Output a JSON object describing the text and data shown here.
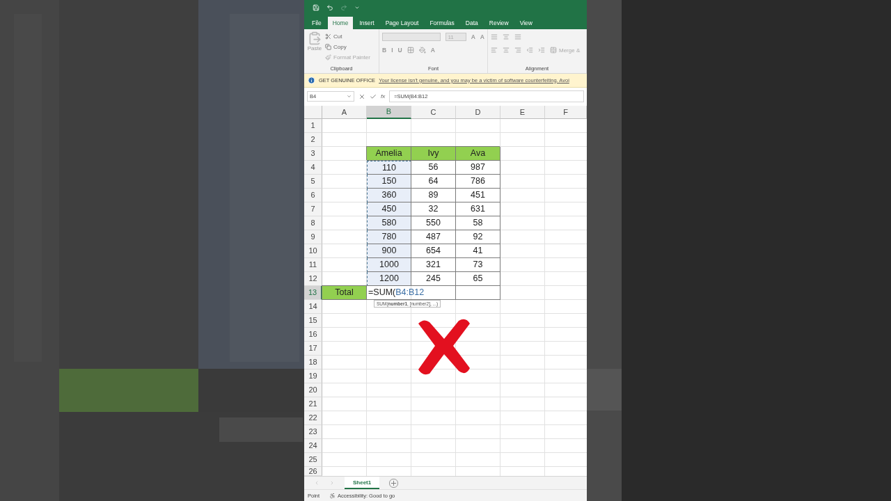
{
  "ribbon_tabs": [
    {
      "label": "File",
      "selected": false
    },
    {
      "label": "Home",
      "selected": true
    },
    {
      "label": "Insert",
      "selected": false
    },
    {
      "label": "Page Layout",
      "selected": false
    },
    {
      "label": "Formulas",
      "selected": false
    },
    {
      "label": "Data",
      "selected": false
    },
    {
      "label": "Review",
      "selected": false
    },
    {
      "label": "View",
      "selected": false
    }
  ],
  "clipboard": {
    "paste": "Paste",
    "cut": "Cut",
    "copy": "Copy",
    "format_painter": "Format Painter",
    "label": "Clipboard"
  },
  "font": {
    "size": "11",
    "grow": [
      "A",
      "A"
    ],
    "styles": [
      "B",
      "I",
      "U"
    ],
    "color_button": "A",
    "label": "Font"
  },
  "alignment": {
    "merge": "Merge &",
    "label": "Alignment"
  },
  "info_bar": {
    "title": "GET GENUINE OFFICE",
    "message": "Your license isn't genuine, and you may be a victim of software counterfeiting. Avoi"
  },
  "formula_bar": {
    "name_box": "B4",
    "function_label": "fx",
    "formula": "=SUM(B4:B12"
  },
  "sheet": {
    "columns": [
      {
        "label": "A",
        "selected": false
      },
      {
        "label": "B",
        "selected": true
      },
      {
        "label": "C",
        "selected": false
      },
      {
        "label": "D",
        "selected": false
      },
      {
        "label": "E",
        "selected": false
      },
      {
        "label": "F",
        "selected": false
      }
    ],
    "rows": [
      {
        "number": "1",
        "selected": false
      },
      {
        "number": "2",
        "selected": false
      },
      {
        "number": "3",
        "selected": false,
        "cells": [
          {
            "kind": "empty"
          },
          {
            "kind": "header",
            "text": "Amelia"
          },
          {
            "kind": "header",
            "text": "Ivy"
          },
          {
            "kind": "header",
            "text": "Ava"
          }
        ]
      },
      {
        "number": "4",
        "selected": false,
        "cells": [
          {
            "kind": "empty"
          },
          {
            "kind": "value",
            "text": "110",
            "marked": true
          },
          {
            "kind": "value",
            "text": "56"
          },
          {
            "kind": "value",
            "text": "987"
          }
        ]
      },
      {
        "number": "5",
        "selected": false,
        "cells": [
          {
            "kind": "empty"
          },
          {
            "kind": "value",
            "text": "150",
            "marked": true
          },
          {
            "kind": "value",
            "text": "64"
          },
          {
            "kind": "value",
            "text": "786"
          }
        ]
      },
      {
        "number": "6",
        "selected": false,
        "cells": [
          {
            "kind": "empty"
          },
          {
            "kind": "value",
            "text": "360",
            "marked": true
          },
          {
            "kind": "value",
            "text": "89"
          },
          {
            "kind": "value",
            "text": "451"
          }
        ]
      },
      {
        "number": "7",
        "selected": false,
        "cells": [
          {
            "kind": "empty"
          },
          {
            "kind": "value",
            "text": "450",
            "marked": true
          },
          {
            "kind": "value",
            "text": "32"
          },
          {
            "kind": "value",
            "text": "631"
          }
        ]
      },
      {
        "number": "8",
        "selected": false,
        "cells": [
          {
            "kind": "empty"
          },
          {
            "kind": "value",
            "text": "580",
            "marked": true
          },
          {
            "kind": "value",
            "text": "550"
          },
          {
            "kind": "value",
            "text": "58"
          }
        ]
      },
      {
        "number": "9",
        "selected": false,
        "cells": [
          {
            "kind": "empty"
          },
          {
            "kind": "value",
            "text": "780",
            "marked": true
          },
          {
            "kind": "value",
            "text": "487"
          },
          {
            "kind": "value",
            "text": "92"
          }
        ]
      },
      {
        "number": "10",
        "selected": false,
        "cells": [
          {
            "kind": "empty"
          },
          {
            "kind": "value",
            "text": "900",
            "marked": true
          },
          {
            "kind": "value",
            "text": "654"
          },
          {
            "kind": "value",
            "text": "41"
          }
        ]
      },
      {
        "number": "11",
        "selected": false,
        "cells": [
          {
            "kind": "empty"
          },
          {
            "kind": "value",
            "text": "1000",
            "marked": true
          },
          {
            "kind": "value",
            "text": "321"
          },
          {
            "kind": "value",
            "text": "73"
          }
        ]
      },
      {
        "number": "12",
        "selected": false,
        "cells": [
          {
            "kind": "empty"
          },
          {
            "kind": "value",
            "text": "1200",
            "marked": true
          },
          {
            "kind": "value",
            "text": "245"
          },
          {
            "kind": "value",
            "text": "65"
          }
        ]
      },
      {
        "number": "13",
        "selected": true,
        "cells": [
          {
            "kind": "label",
            "text": "Total"
          },
          {
            "kind": "editing",
            "text": "=SUM(",
            "reference": "B4:B12"
          },
          {
            "kind": "blank"
          }
        ]
      },
      {
        "number": "14",
        "selected": false
      },
      {
        "number": "15",
        "selected": false
      },
      {
        "number": "16",
        "selected": false
      },
      {
        "number": "17",
        "selected": false
      },
      {
        "number": "18",
        "selected": false
      },
      {
        "number": "19",
        "selected": false
      },
      {
        "number": "20",
        "selected": false
      },
      {
        "number": "21",
        "selected": false
      },
      {
        "number": "22",
        "selected": false
      },
      {
        "number": "23",
        "selected": false
      },
      {
        "number": "24",
        "selected": false
      },
      {
        "number": "25",
        "selected": false
      },
      {
        "number": "26",
        "selected": false
      }
    ],
    "tooltip": "SUM(**number1**, [number2], ...)"
  },
  "sheet_tabs": [
    {
      "label": "Sheet1",
      "selected": true
    }
  ],
  "status_bar": {
    "mode": "Point",
    "accessibility": "Accessibility: Good to go"
  }
}
